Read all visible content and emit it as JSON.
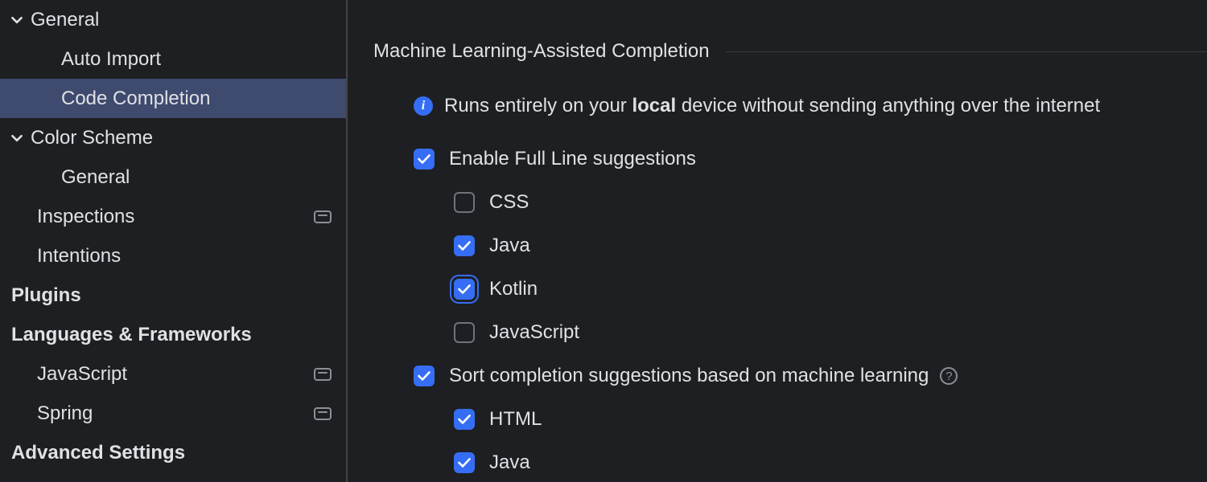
{
  "sidebar": {
    "items": [
      {
        "label": "General",
        "indent": 0,
        "chevron": true,
        "bold": false,
        "badge": false,
        "selected": false
      },
      {
        "label": "Auto Import",
        "indent": 2,
        "chevron": false,
        "bold": false,
        "badge": false,
        "selected": false
      },
      {
        "label": "Code Completion",
        "indent": 2,
        "chevron": false,
        "bold": false,
        "badge": false,
        "selected": true
      },
      {
        "label": "Color Scheme",
        "indent": 0,
        "chevron": true,
        "bold": false,
        "badge": false,
        "selected": false
      },
      {
        "label": "General",
        "indent": 2,
        "chevron": false,
        "bold": false,
        "badge": false,
        "selected": false
      },
      {
        "label": "Inspections",
        "indent": 1,
        "chevron": false,
        "bold": false,
        "badge": true,
        "selected": false
      },
      {
        "label": "Intentions",
        "indent": 1,
        "chevron": false,
        "bold": false,
        "badge": false,
        "selected": false
      },
      {
        "label": "Plugins",
        "indent": 0,
        "chevron": false,
        "bold": true,
        "badge": false,
        "selected": false
      },
      {
        "label": "Languages & Frameworks",
        "indent": 0,
        "chevron": false,
        "bold": true,
        "badge": false,
        "selected": false
      },
      {
        "label": "JavaScript",
        "indent": 1,
        "chevron": false,
        "bold": false,
        "badge": true,
        "selected": false
      },
      {
        "label": "Spring",
        "indent": 1,
        "chevron": false,
        "bold": false,
        "badge": true,
        "selected": false
      },
      {
        "label": "Advanced Settings",
        "indent": 0,
        "chevron": false,
        "bold": true,
        "badge": false,
        "selected": false
      }
    ]
  },
  "panel": {
    "section_title": "Machine Learning-Assisted Completion",
    "info_prefix": "Runs entirely on your ",
    "info_bold": "local",
    "info_suffix": " device without sending anything over the internet",
    "enable_full_line": {
      "label": "Enable Full Line suggestions",
      "checked": true,
      "focused": false
    },
    "langs_full_line": [
      {
        "label": "CSS",
        "checked": false,
        "focused": false
      },
      {
        "label": "Java",
        "checked": true,
        "focused": false
      },
      {
        "label": "Kotlin",
        "checked": true,
        "focused": true
      },
      {
        "label": "JavaScript",
        "checked": false,
        "focused": false
      }
    ],
    "sort_ml": {
      "label": "Sort completion suggestions based on machine learning",
      "checked": true,
      "focused": false
    },
    "langs_sort": [
      {
        "label": "HTML",
        "checked": true,
        "focused": false
      },
      {
        "label": "Java",
        "checked": true,
        "focused": false
      }
    ]
  }
}
